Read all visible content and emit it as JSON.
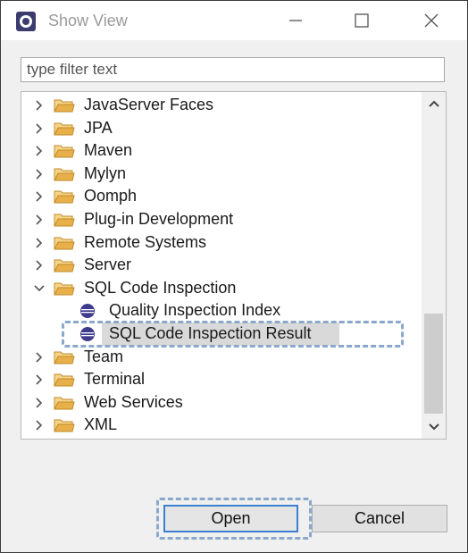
{
  "window": {
    "title": "Show View",
    "app_icon": "eclipse-view-icon",
    "controls": [
      "minimize",
      "maximize",
      "close"
    ]
  },
  "filter": {
    "placeholder": "type filter text",
    "value": ""
  },
  "tree": {
    "items": [
      {
        "label": "JavaServer Faces",
        "type": "folder",
        "expanded": false
      },
      {
        "label": "JPA",
        "type": "folder",
        "expanded": false
      },
      {
        "label": "Maven",
        "type": "folder",
        "expanded": false
      },
      {
        "label": "Mylyn",
        "type": "folder",
        "expanded": false
      },
      {
        "label": "Oomph",
        "type": "folder",
        "expanded": false
      },
      {
        "label": "Plug-in Development",
        "type": "folder",
        "expanded": false
      },
      {
        "label": "Remote Systems",
        "type": "folder",
        "expanded": false
      },
      {
        "label": "Server",
        "type": "folder",
        "expanded": false
      },
      {
        "label": "SQL Code Inspection",
        "type": "folder",
        "expanded": true
      },
      {
        "label": "Quality Inspection Index",
        "type": "view",
        "selected": false
      },
      {
        "label": "SQL Code Inspection Result",
        "type": "view",
        "selected": true
      },
      {
        "label": "Team",
        "type": "folder",
        "expanded": false
      },
      {
        "label": "Terminal",
        "type": "folder",
        "expanded": false
      },
      {
        "label": "Web Services",
        "type": "folder",
        "expanded": false
      },
      {
        "label": "XML",
        "type": "folder",
        "expanded": false
      }
    ]
  },
  "buttons": {
    "open": "Open",
    "cancel": "Cancel"
  },
  "colors": {
    "focus_border": "#3c7fd0",
    "highlight_dash": "#8aa8cc",
    "folder": "#e8b04a",
    "selection": "#d9d9d9"
  }
}
